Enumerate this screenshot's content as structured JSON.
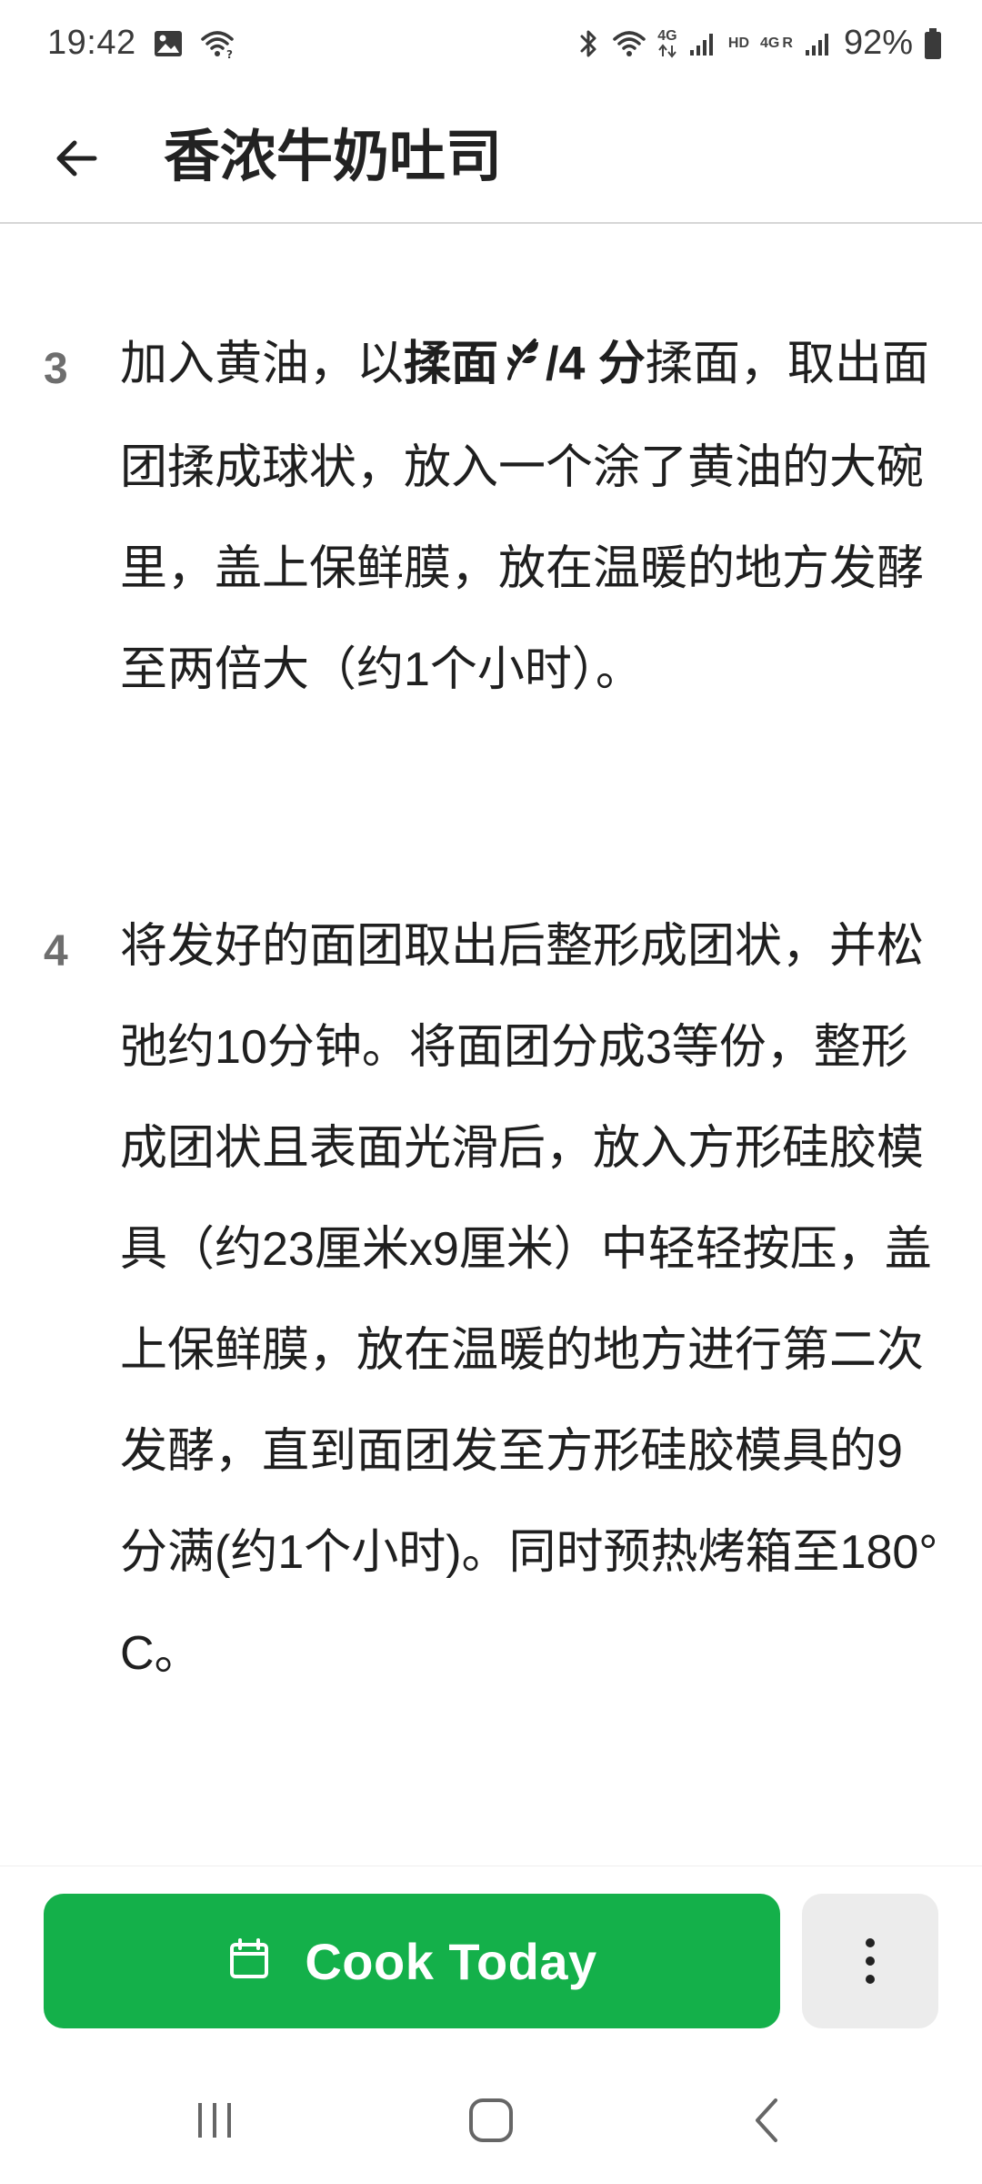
{
  "status_bar": {
    "time": "19:42",
    "battery_text": "92%",
    "network_hd": "HD",
    "network_4g_1": "4G",
    "network_4g_2": "4G",
    "network_r": "R",
    "icons": [
      "image-icon",
      "wifi-icon",
      "bluetooth-icon",
      "wifi-icon",
      "signal-icon",
      "signal-icon",
      "battery-icon"
    ]
  },
  "header": {
    "title": "香浓牛奶吐司",
    "back_icon": "arrow-left-icon"
  },
  "steps": [
    {
      "number": "3",
      "text_before": "加入黄油，以",
      "bold_label": "揉面",
      "bold_suffix": "/4 分",
      "text_after": "揉面，取出面团揉成球状，放入一个涂了黄油的大碗里，盖上保鲜膜，放在温暖的地方发酵至两倍大（约1个小时）。"
    },
    {
      "number": "4",
      "text": "将发好的面团取出后整形成团状，并松弛约10分钟。将面团分成3等份，整形成团状且表面光滑后，放入方形硅胶模具（约23厘米x9厘米）中轻轻按压，盖上保鲜膜，放在温暖的地方进行第二次发酵，直到面团发至方形硅胶模具的9分满(约1个小时)。同时预热烤箱至180°C。"
    }
  ],
  "actions": {
    "cook_today_label": "Cook Today",
    "cook_today_icon": "calendar-icon",
    "more_icon": "more-vertical-icon"
  },
  "colors": {
    "primary_green": "#14b04a",
    "more_button_bg": "#ececec",
    "step_number": "#6e6e6e"
  },
  "nav_bar": {
    "icons": [
      "recent-apps-icon",
      "home-icon",
      "back-icon"
    ]
  }
}
